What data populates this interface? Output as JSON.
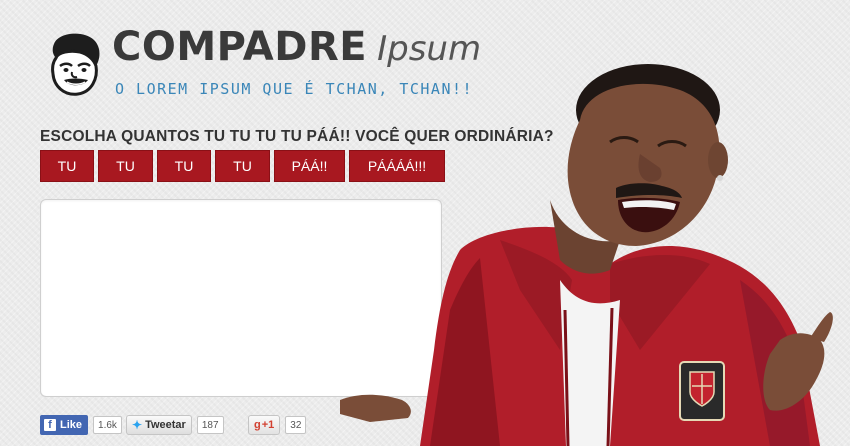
{
  "header": {
    "title_main": "COMPADRE",
    "title_script": "Ipsum",
    "tagline": "O LOREM IPSUM QUE É TCHAN, TCHAN!!",
    "logo_icon": "caricature-face-icon"
  },
  "prompt": {
    "question": "ESCOLHA QUANTOS TU TU TU TU PÁÁ!! VOCÊ QUER ORDINÁRIA?",
    "buttons": [
      {
        "label": "TU"
      },
      {
        "label": "TU"
      },
      {
        "label": "TU"
      },
      {
        "label": "TU"
      },
      {
        "label": "PÁÁ!!"
      },
      {
        "label": "PÁÁÁÁ!!!"
      }
    ]
  },
  "output": {
    "value": ""
  },
  "social": {
    "facebook": {
      "label": "Like",
      "count": "1.6k",
      "icon": "facebook-icon"
    },
    "twitter": {
      "label": "Tweetar",
      "count": "187",
      "icon": "twitter-bird-icon"
    },
    "google": {
      "label": "+1",
      "count": "32",
      "icon": "google-plus-icon"
    }
  },
  "colors": {
    "button_red": "#a81820",
    "tagline_blue": "#3a86b8",
    "title_gray": "#3a3a3a",
    "jacket_red": "#b11e2a"
  }
}
